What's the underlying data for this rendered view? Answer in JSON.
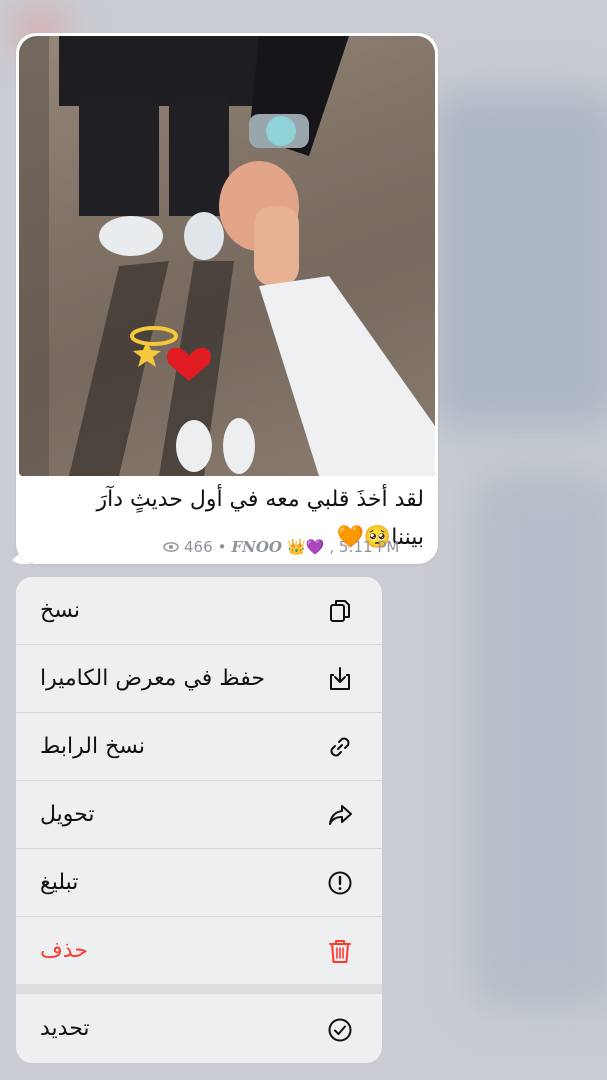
{
  "message": {
    "caption_line1": "لقد أخذَ قلبي معه في أول حديثٍ دآرَ",
    "caption_line2": "بيننا🥺🧡",
    "views": "466",
    "signature": "FNOO",
    "signature_emoji": "👑💜",
    "time": ", 5:11 PM"
  },
  "menu": {
    "items": [
      {
        "label": "نسخ",
        "icon": "copy-icon"
      },
      {
        "label": "حفظ في معرض الكاميرا",
        "icon": "save-to-gallery-icon"
      },
      {
        "label": "نسخ الرابط",
        "icon": "link-icon"
      },
      {
        "label": "تحويل",
        "icon": "forward-icon"
      },
      {
        "label": "تبليغ",
        "icon": "report-icon"
      },
      {
        "label": "حذف",
        "icon": "trash-icon"
      },
      {
        "label": "تحديد",
        "icon": "select-check-icon"
      }
    ]
  },
  "colors": {
    "destructive": "#ff3b30",
    "menu_bg": "#eeeff1",
    "bubble_bg": "#ffffff"
  }
}
